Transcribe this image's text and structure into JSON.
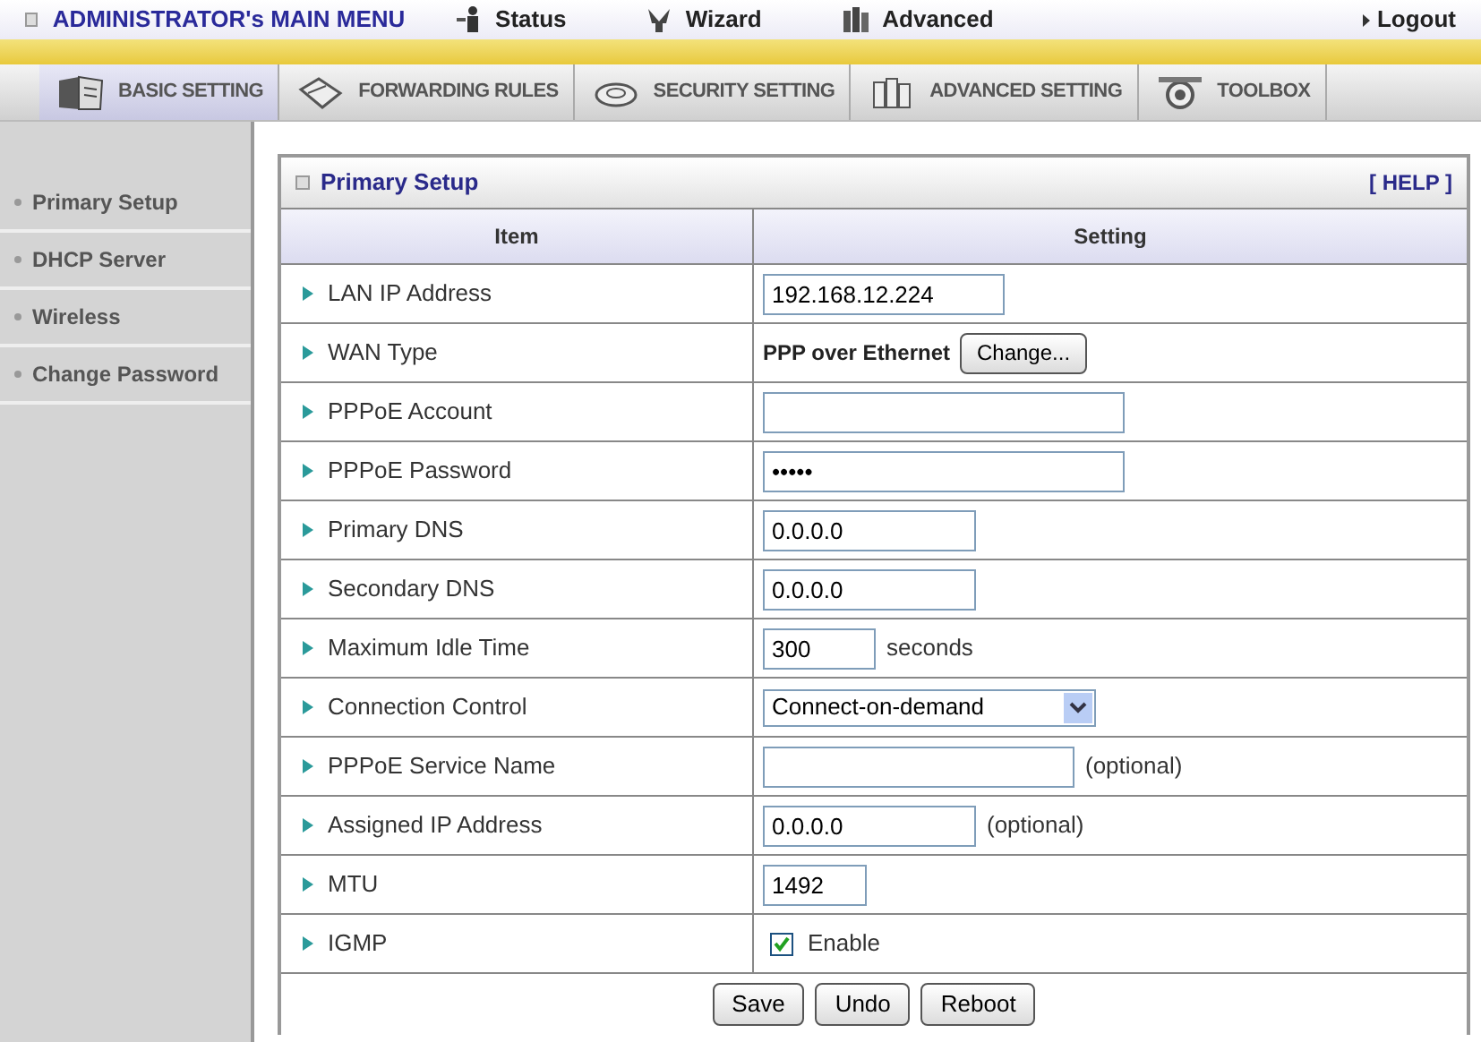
{
  "top_menu": {
    "title": "ADMINISTRATOR's MAIN MENU",
    "items": [
      {
        "label": "Status",
        "kind": "status"
      },
      {
        "label": "Wizard",
        "kind": "wizard"
      },
      {
        "label": "Advanced",
        "kind": "advanced"
      }
    ],
    "logout": "Logout"
  },
  "tabs": [
    {
      "label": "BASIC SETTING",
      "kind": "basic",
      "selected": true
    },
    {
      "label": "FORWARDING RULES",
      "kind": "forwarding",
      "selected": false
    },
    {
      "label": "SECURITY SETTING",
      "kind": "security",
      "selected": false
    },
    {
      "label": "ADVANCED SETTING",
      "kind": "advanced",
      "selected": false
    },
    {
      "label": "TOOLBOX",
      "kind": "toolbox",
      "selected": false
    }
  ],
  "sidebar": {
    "items": [
      "Primary Setup",
      "DHCP Server",
      "Wireless",
      "Change Password"
    ]
  },
  "panel": {
    "title": "Primary Setup",
    "help": "[ HELP ]",
    "columns": [
      "Item",
      "Setting"
    ],
    "rows": [
      {
        "label": "LAN IP Address",
        "kind": "text",
        "value": "192.168.12.224"
      },
      {
        "label": "WAN Type",
        "kind": "wantype",
        "value": "PPP over Ethernet",
        "button": "Change..."
      },
      {
        "label": "PPPoE Account",
        "kind": "text",
        "value": ""
      },
      {
        "label": "PPPoE Password",
        "kind": "text",
        "value": "•••••"
      },
      {
        "label": "Primary DNS",
        "kind": "text",
        "value": "0.0.0.0"
      },
      {
        "label": "Secondary DNS",
        "kind": "text",
        "value": "0.0.0.0"
      },
      {
        "label": "Maximum Idle Time",
        "kind": "text",
        "value": "300",
        "unit": "seconds"
      },
      {
        "label": "Connection Control",
        "kind": "select",
        "value": "Connect-on-demand"
      },
      {
        "label": "PPPoE Service Name",
        "kind": "text",
        "value": "",
        "note": "(optional)"
      },
      {
        "label": "Assigned IP Address",
        "kind": "text",
        "value": "0.0.0.0",
        "note": "(optional)"
      },
      {
        "label": "MTU",
        "kind": "text",
        "value": "1492"
      },
      {
        "label": "IGMP",
        "kind": "checkbox",
        "checked": true,
        "value": "Enable"
      }
    ],
    "buttons": [
      "Save",
      "Undo",
      "Reboot"
    ]
  }
}
